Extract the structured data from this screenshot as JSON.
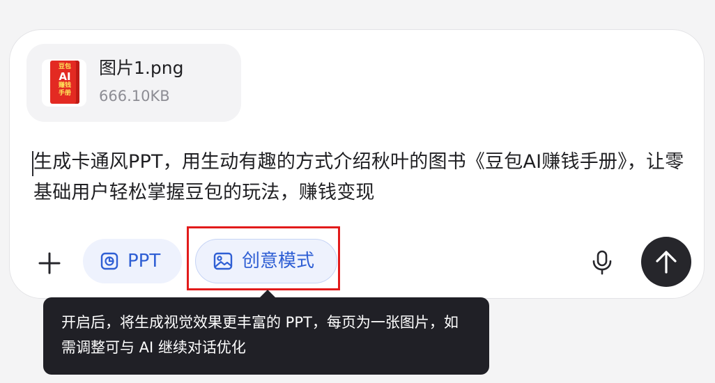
{
  "attachment": {
    "file_name": "图片1.png",
    "file_size": "666.10KB",
    "thumbnail": {
      "line1": "豆包",
      "line2": "AI",
      "line3": "赚钱",
      "line4": "手册"
    }
  },
  "composer": {
    "prompt_text": "生成卡通风PPT，用生动有趣的方式介绍秋叶的图书《豆包AI赚钱手册》，让零基础用户轻松掌握豆包的玩法，赚钱变现"
  },
  "toolbar": {
    "add_icon": "plus-icon",
    "ppt_label": "PPT",
    "ppt_icon": "pie-chart-icon",
    "creative_label": "创意模式",
    "creative_icon": "image-icon",
    "mic_icon": "microphone-icon",
    "send_icon": "arrow-up-icon"
  },
  "tooltip": {
    "text": "开启后，将生成视觉效果更丰富的 PPT，每页为一张图片，如需调整可与 AI 继续对话优化"
  },
  "colors": {
    "accent_blue": "#2f5fd4",
    "pill_bg": "#eef2fd",
    "send_bg": "#26262b",
    "highlight_red": "#e21b1b",
    "tooltip_bg": "#202026"
  }
}
